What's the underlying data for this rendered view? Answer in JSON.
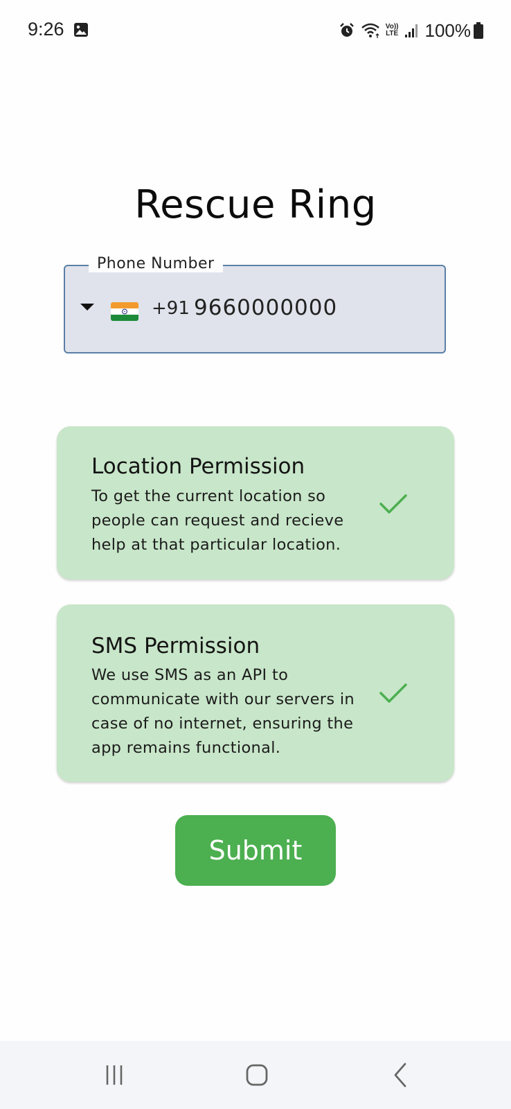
{
  "status_bar": {
    "time": "9:26",
    "battery": "100%",
    "network_badge_top": "Vo))",
    "network_badge_bottom": "LTE",
    "icons": [
      "gallery-icon",
      "alarm-icon",
      "wifi-icon",
      "volte-icon",
      "signal-icon",
      "battery-icon"
    ]
  },
  "app": {
    "title": "Rescue Ring"
  },
  "phone_field": {
    "label": "Phone Number",
    "country_flag": "india-flag",
    "dial_code": "+91",
    "value": "9660000000"
  },
  "permissions": [
    {
      "title": "Location Permission",
      "description": "To get the current location so people can request and recieve help at that particular location.",
      "granted": true
    },
    {
      "title": "SMS Permission",
      "description": "We use SMS as an API to communicate with our servers in case of no internet, ensuring the app remains functional.",
      "granted": true
    }
  ],
  "submit": {
    "label": "Submit"
  },
  "colors": {
    "card_background": "#c8e6c9",
    "check": "#4caf50",
    "submit_background": "#4caf50",
    "field_background": "#e0e3eb",
    "field_border": "#5a7fa6"
  },
  "nav_bar": {
    "buttons": [
      "recents-icon",
      "home-icon",
      "back-icon"
    ]
  }
}
